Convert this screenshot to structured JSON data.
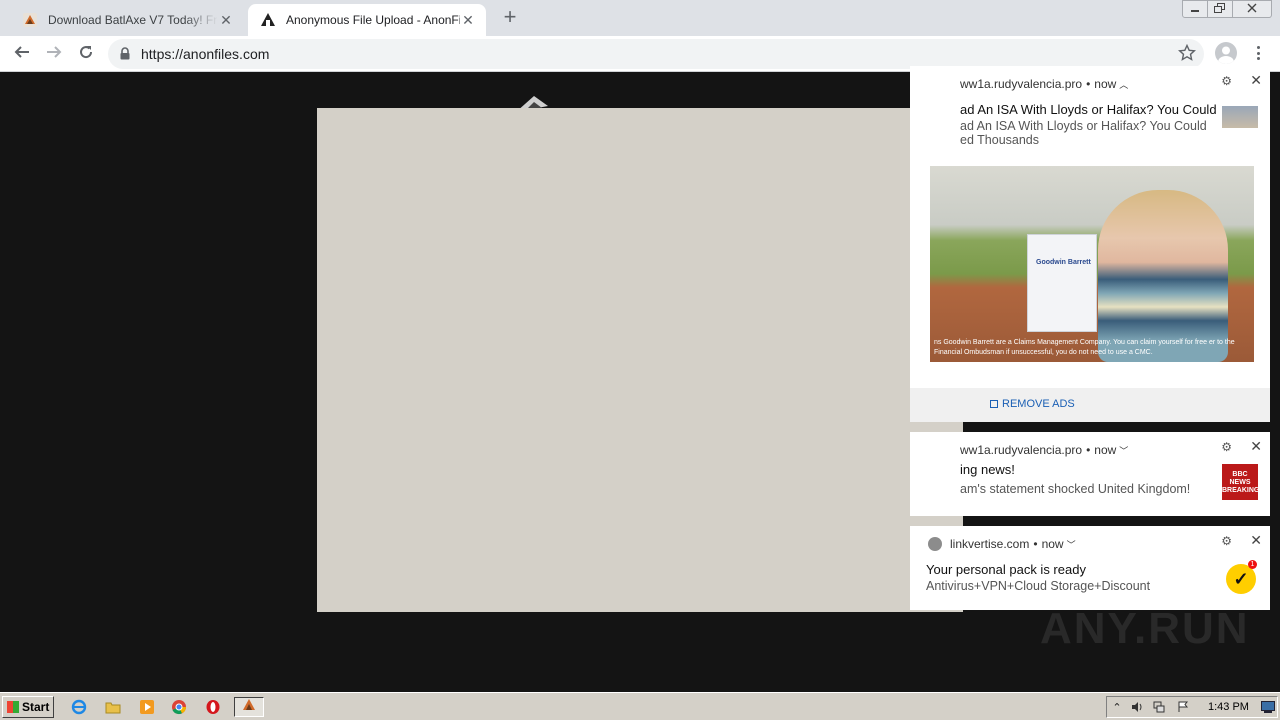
{
  "browser": {
    "tabs": [
      {
        "title": "Download BatlAxe V7 Today! Free Sp",
        "favicon": "batlaxe-icon",
        "active": false
      },
      {
        "title": "Anonymous File Upload - AnonFiles",
        "favicon": "anonfiles-icon",
        "active": true
      }
    ],
    "address_bar": {
      "url": "https://anonfiles.com"
    },
    "window_controls": [
      "minimize-icon",
      "maximize-icon",
      "close-icon"
    ]
  },
  "notifications": [
    {
      "source": "ww1a.rudyvalencia.pro",
      "time": "now",
      "title": "ad An ISA With Lloyds or Halifax? You Could",
      "body": "ad An ISA With Lloyds or Halifax? You Could ed Thousands",
      "image_brand": "Goodwin Barrett",
      "image_caption": "ns Goodwin Barrett are a Claims Management Company. You can claim yourself for free er to the Financial Ombudsman if unsuccessful, you do not need to use a CMC.",
      "footer_link": "REMOVE ADS"
    },
    {
      "source": "ww1a.rudyvalencia.pro",
      "time": "now",
      "title": "ing news!",
      "body": "am's statement shocked United Kingdom!",
      "thumb_text": "BBC NEWS BREAKING"
    },
    {
      "source": "linkvertise.com",
      "time": "now",
      "title": "Your personal pack is ready",
      "body": "Antivirus+VPN+Cloud Storage+Discount",
      "badge": "1"
    }
  ],
  "watermark": "ANY.RUN",
  "taskbar": {
    "start_label": "Start",
    "apps": [
      "internet-explorer-icon",
      "folder-icon",
      "media-player-icon",
      "chrome-icon",
      "opera-icon",
      "batlaxe-icon"
    ],
    "clock": "1:43 PM"
  }
}
